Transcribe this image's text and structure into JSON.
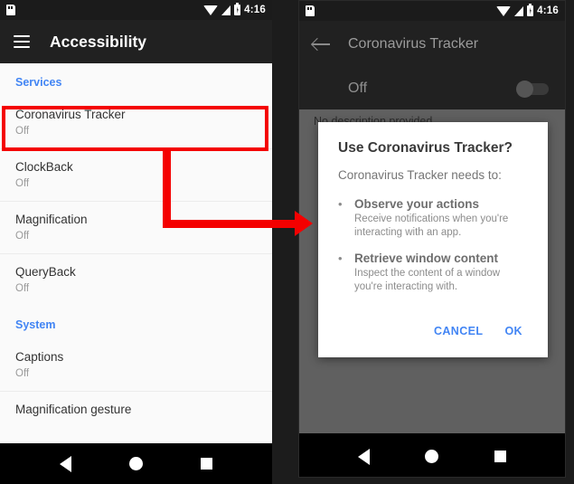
{
  "status_bar": {
    "sd_icon": "sd-card-icon",
    "wifi_icon": "wifi-icon",
    "signal_icon": "cell-signal-icon",
    "battery_icon": "battery-charging-icon",
    "time": "4:16"
  },
  "left_phone": {
    "appbar": {
      "menu_icon": "hamburger-menu-icon",
      "title": "Accessibility"
    },
    "sections": [
      {
        "header": "Services",
        "rows": [
          {
            "title": "Coronavirus Tracker",
            "sub": "Off",
            "highlighted": true
          },
          {
            "title": "ClockBack",
            "sub": "Off",
            "highlighted": false
          },
          {
            "title": "Magnification",
            "sub": "Off",
            "highlighted": false
          },
          {
            "title": "QueryBack",
            "sub": "Off",
            "highlighted": false
          }
        ]
      },
      {
        "header": "System",
        "rows": [
          {
            "title": "Captions",
            "sub": "Off",
            "highlighted": false
          },
          {
            "title": "Magnification gesture",
            "sub": "",
            "highlighted": false
          }
        ]
      }
    ]
  },
  "right_phone": {
    "appbar": {
      "back_icon": "back-arrow-icon",
      "title": "Coronavirus Tracker"
    },
    "toggle": {
      "label": "Off",
      "state": "off"
    },
    "description": "No description provided",
    "dialog": {
      "title": "Use Coronavirus Tracker?",
      "subtitle": "Coronavirus Tracker needs to:",
      "bullets": [
        {
          "dot": "•",
          "head": "Observe your actions",
          "body": "Receive notifications when you're interacting with an app."
        },
        {
          "dot": "•",
          "head": "Retrieve window content",
          "body": "Inspect the content of a window you're interacting with."
        }
      ],
      "cancel_label": "CANCEL",
      "ok_label": "OK"
    }
  },
  "nav_bar": {
    "back_icon": "nav-back-icon",
    "home_icon": "nav-home-icon",
    "recents_icon": "nav-recents-icon"
  },
  "annotation": {
    "accent_color": "#f40000",
    "arrow_icon": "red-flow-arrow"
  }
}
